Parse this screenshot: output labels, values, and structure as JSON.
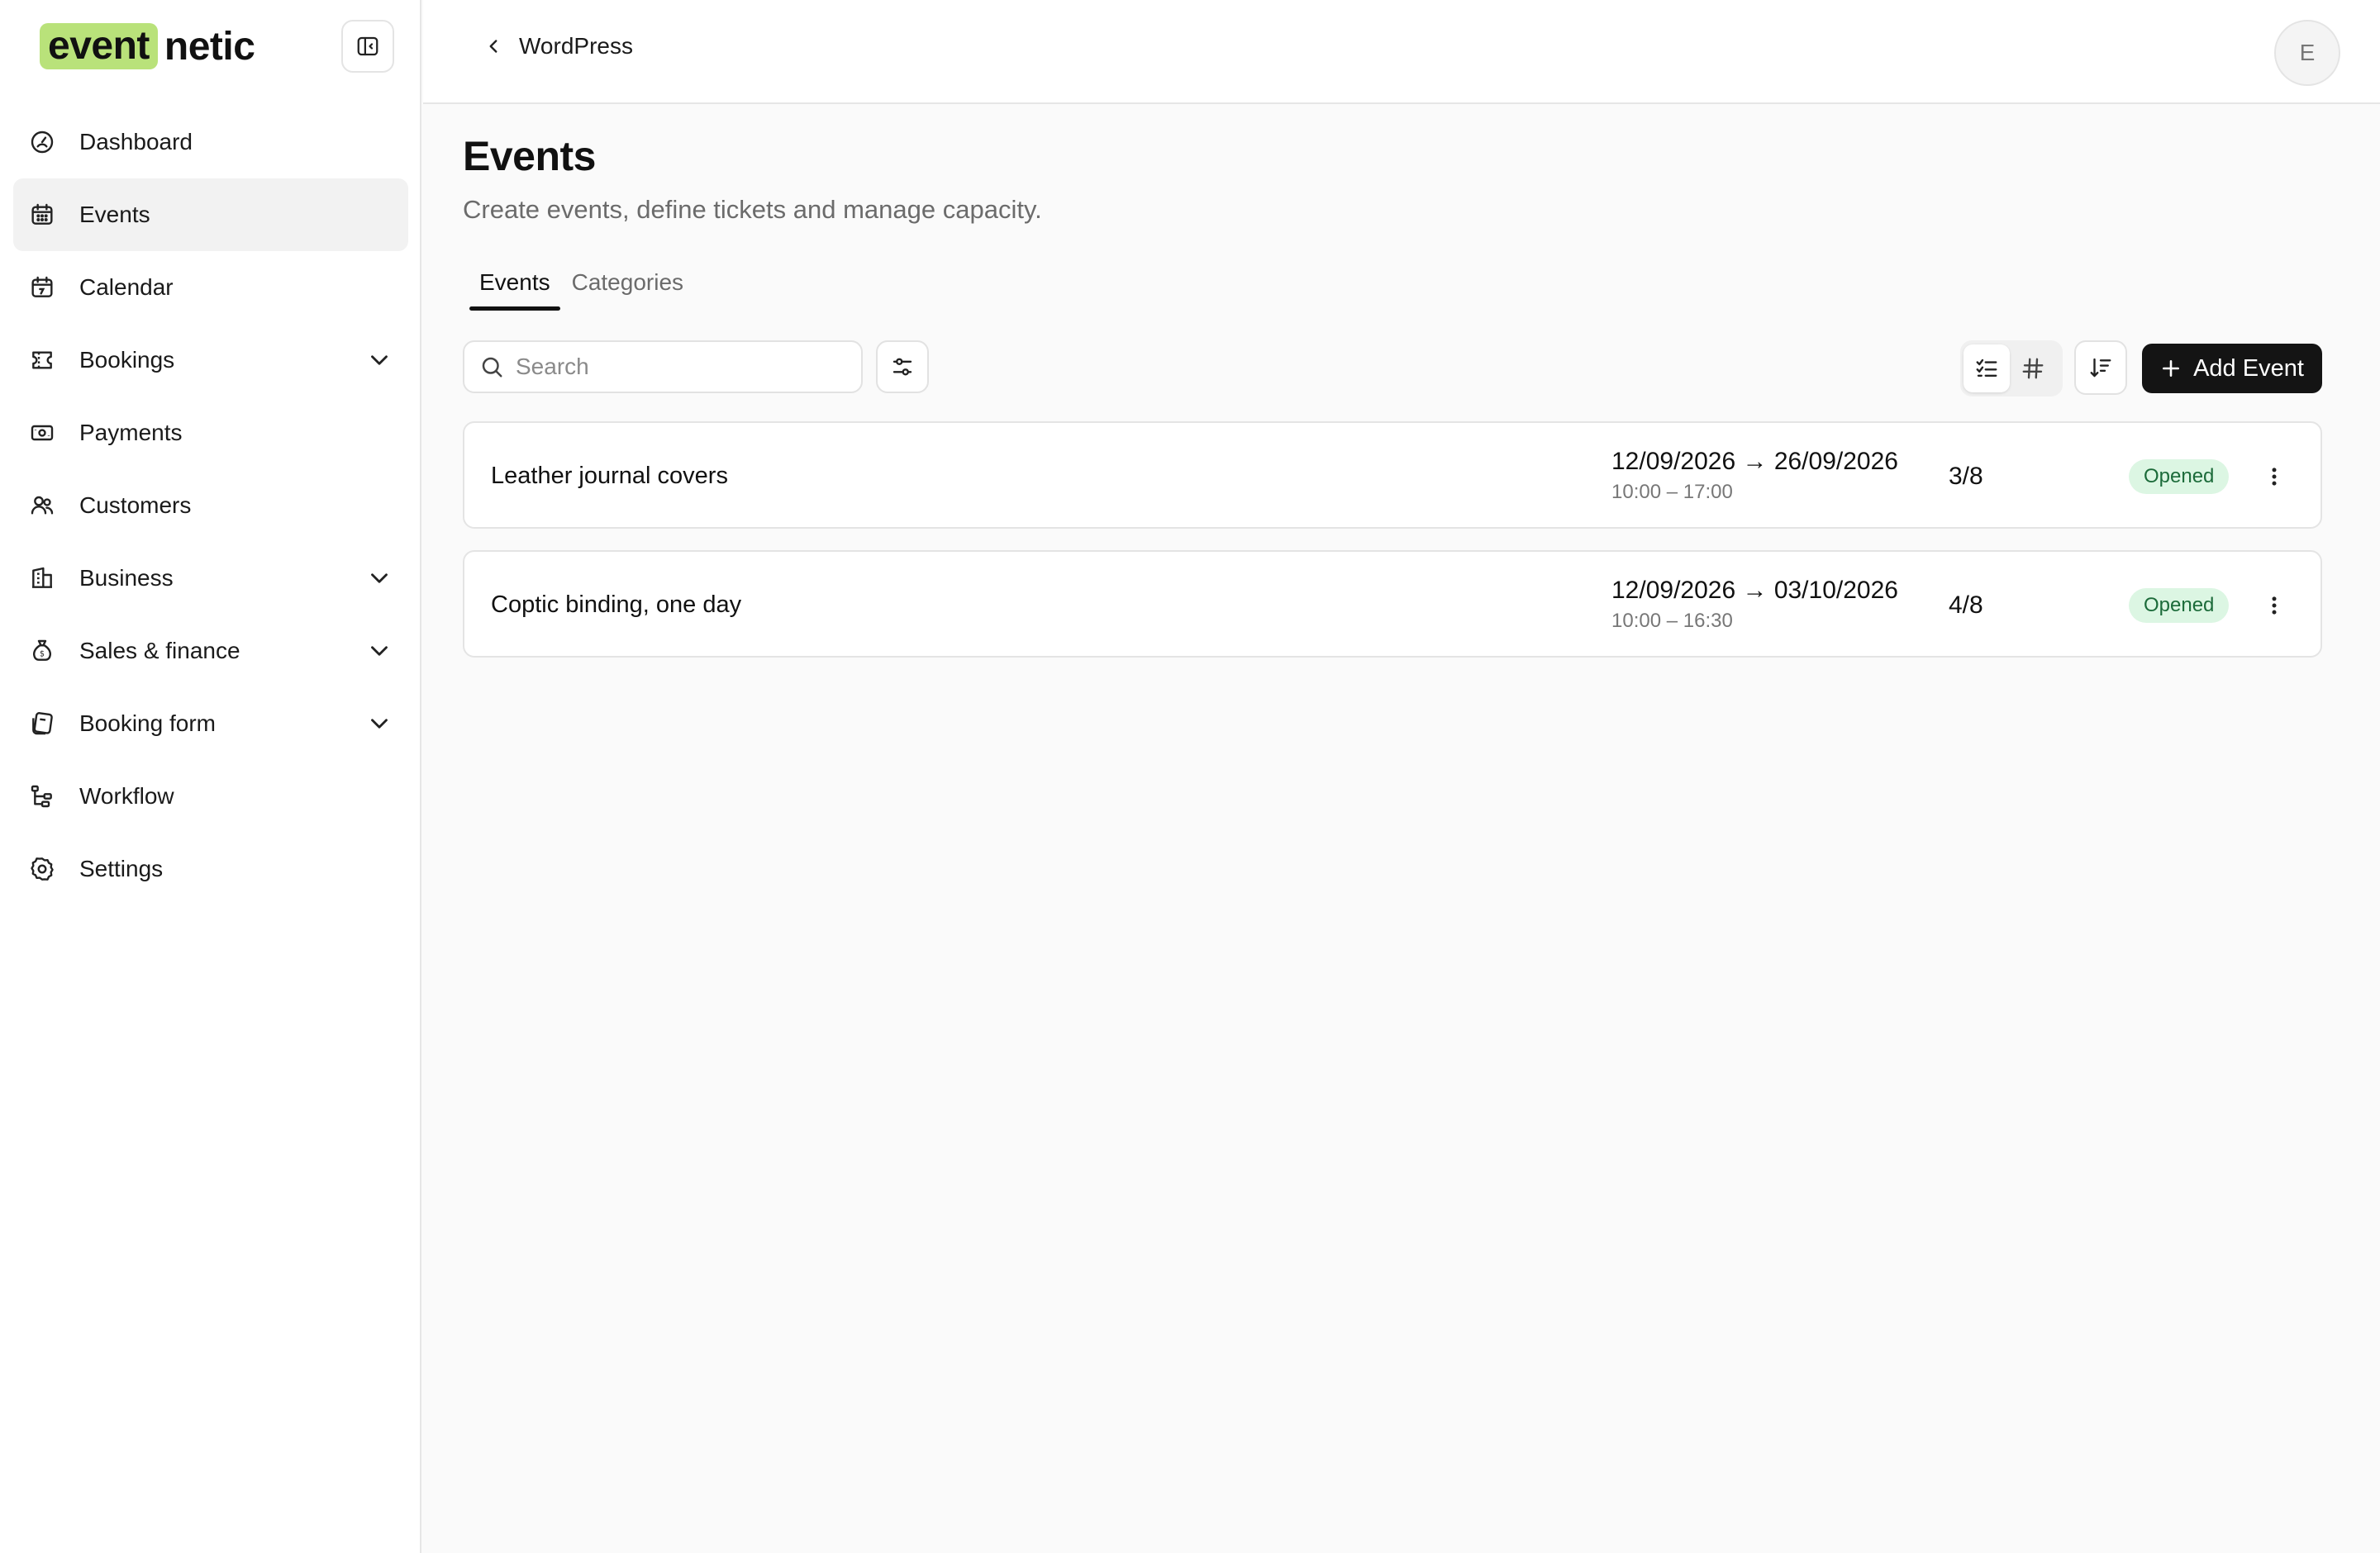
{
  "brand": {
    "part1": "event",
    "part2": "netic",
    "highlight_color": "#b9e27a"
  },
  "sidebar": {
    "items": [
      {
        "label": "Dashboard",
        "icon": "dashboard-icon",
        "active": false,
        "expandable": false
      },
      {
        "label": "Events",
        "icon": "calendar-grid-icon",
        "active": true,
        "expandable": false
      },
      {
        "label": "Calendar",
        "icon": "calendar-icon",
        "active": false,
        "expandable": false
      },
      {
        "label": "Bookings",
        "icon": "ticket-icon",
        "active": false,
        "expandable": true
      },
      {
        "label": "Payments",
        "icon": "money-icon",
        "active": false,
        "expandable": false
      },
      {
        "label": "Customers",
        "icon": "users-icon",
        "active": false,
        "expandable": false
      },
      {
        "label": "Business",
        "icon": "building-icon",
        "active": false,
        "expandable": true
      },
      {
        "label": "Sales & finance",
        "icon": "money-bag-icon",
        "active": false,
        "expandable": true
      },
      {
        "label": "Booking form",
        "icon": "form-icon",
        "active": false,
        "expandable": true
      },
      {
        "label": "Workflow",
        "icon": "workflow-icon",
        "active": false,
        "expandable": false
      },
      {
        "label": "Settings",
        "icon": "gear-icon",
        "active": false,
        "expandable": false
      }
    ]
  },
  "topbar": {
    "back_label": "WordPress",
    "avatar_initial": "E"
  },
  "main": {
    "title": "Events",
    "subtitle": "Create events, define tickets and manage capacity.",
    "tabs": [
      {
        "label": "Events",
        "active": true
      },
      {
        "label": "Categories",
        "active": false
      }
    ],
    "search": {
      "placeholder": "Search",
      "value": ""
    },
    "add_button_label": "Add Event"
  },
  "events": [
    {
      "name": "Leather journal covers",
      "dates": "12/09/2026 → 26/09/2026",
      "time": "10:00 – 17:00",
      "capacity": "3/8",
      "status": "Opened"
    },
    {
      "name": "Coptic binding, one day",
      "dates": "12/09/2026 → 03/10/2026",
      "time": "10:00 – 16:30",
      "capacity": "4/8",
      "status": "Opened"
    }
  ],
  "colors": {
    "status_bg": "#dcf6e3",
    "status_text": "#1c6b3a",
    "primary_button": "#141414"
  }
}
